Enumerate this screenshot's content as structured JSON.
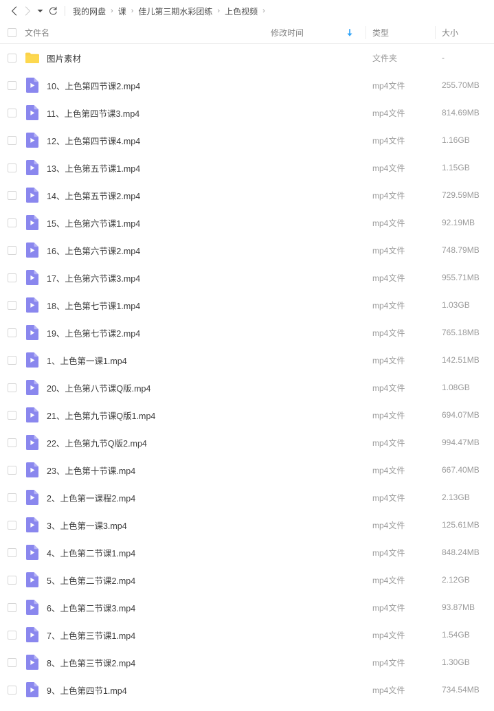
{
  "toolbar": {
    "back_icon": "chevron-left-icon",
    "forward_icon": "chevron-right-icon",
    "dropdown_icon": "caret-down-icon",
    "refresh_icon": "refresh-icon",
    "breadcrumb": [
      "我的网盘",
      "课",
      "佳儿第三期水彩团练",
      "上色视频"
    ],
    "separator": "›"
  },
  "colors": {
    "accent": "#2ca1f7",
    "folder": "#fbd24a",
    "video": "#8a87ee",
    "text": "#3d3d3d",
    "muted": "#9b9b9b"
  },
  "columns": {
    "name": "文件名",
    "modified": "修改时间",
    "type": "类型",
    "size": "大小",
    "sort_icon": "arrow-down-icon"
  },
  "files": [
    {
      "name": "图片素材",
      "icon": "folder-icon",
      "modified": "",
      "type": "文件夹",
      "size": "-"
    },
    {
      "name": "10、上色第四节课2.mp4",
      "icon": "video-file-icon",
      "modified": "",
      "type": "mp4文件",
      "size": "255.70MB"
    },
    {
      "name": "11、上色第四节课3.mp4",
      "icon": "video-file-icon",
      "modified": "",
      "type": "mp4文件",
      "size": "814.69MB"
    },
    {
      "name": "12、上色第四节课4.mp4",
      "icon": "video-file-icon",
      "modified": "",
      "type": "mp4文件",
      "size": "1.16GB"
    },
    {
      "name": "13、上色第五节课1.mp4",
      "icon": "video-file-icon",
      "modified": "",
      "type": "mp4文件",
      "size": "1.15GB"
    },
    {
      "name": "14、上色第五节课2.mp4",
      "icon": "video-file-icon",
      "modified": "",
      "type": "mp4文件",
      "size": "729.59MB"
    },
    {
      "name": "15、上色第六节课1.mp4",
      "icon": "video-file-icon",
      "modified": "",
      "type": "mp4文件",
      "size": "92.19MB"
    },
    {
      "name": "16、上色第六节课2.mp4",
      "icon": "video-file-icon",
      "modified": "",
      "type": "mp4文件",
      "size": "748.79MB"
    },
    {
      "name": "17、上色第六节课3.mp4",
      "icon": "video-file-icon",
      "modified": "",
      "type": "mp4文件",
      "size": "955.71MB"
    },
    {
      "name": "18、上色第七节课1.mp4",
      "icon": "video-file-icon",
      "modified": "",
      "type": "mp4文件",
      "size": "1.03GB"
    },
    {
      "name": "19、上色第七节课2.mp4",
      "icon": "video-file-icon",
      "modified": "",
      "type": "mp4文件",
      "size": "765.18MB"
    },
    {
      "name": "1、上色第一课1.mp4",
      "icon": "video-file-icon",
      "modified": "",
      "type": "mp4文件",
      "size": "142.51MB"
    },
    {
      "name": "20、上色第八节课Q版.mp4",
      "icon": "video-file-icon",
      "modified": "",
      "type": "mp4文件",
      "size": "1.08GB"
    },
    {
      "name": "21、上色第九节课Q版1.mp4",
      "icon": "video-file-icon",
      "modified": "",
      "type": "mp4文件",
      "size": "694.07MB"
    },
    {
      "name": "22、上色第九节Q版2.mp4",
      "icon": "video-file-icon",
      "modified": "",
      "type": "mp4文件",
      "size": "994.47MB"
    },
    {
      "name": "23、上色第十节课.mp4",
      "icon": "video-file-icon",
      "modified": "",
      "type": "mp4文件",
      "size": "667.40MB"
    },
    {
      "name": "2、上色第一课程2.mp4",
      "icon": "video-file-icon",
      "modified": "",
      "type": "mp4文件",
      "size": "2.13GB"
    },
    {
      "name": "3、上色第一课3.mp4",
      "icon": "video-file-icon",
      "modified": "",
      "type": "mp4文件",
      "size": "125.61MB"
    },
    {
      "name": "4、上色第二节课1.mp4",
      "icon": "video-file-icon",
      "modified": "",
      "type": "mp4文件",
      "size": "848.24MB"
    },
    {
      "name": "5、上色第二节课2.mp4",
      "icon": "video-file-icon",
      "modified": "",
      "type": "mp4文件",
      "size": "2.12GB"
    },
    {
      "name": "6、上色第二节课3.mp4",
      "icon": "video-file-icon",
      "modified": "",
      "type": "mp4文件",
      "size": "93.87MB"
    },
    {
      "name": "7、上色第三节课1.mp4",
      "icon": "video-file-icon",
      "modified": "",
      "type": "mp4文件",
      "size": "1.54GB"
    },
    {
      "name": "8、上色第三节课2.mp4",
      "icon": "video-file-icon",
      "modified": "",
      "type": "mp4文件",
      "size": "1.30GB"
    },
    {
      "name": "9、上色第四节1.mp4",
      "icon": "video-file-icon",
      "modified": "",
      "type": "mp4文件",
      "size": "734.54MB"
    }
  ]
}
